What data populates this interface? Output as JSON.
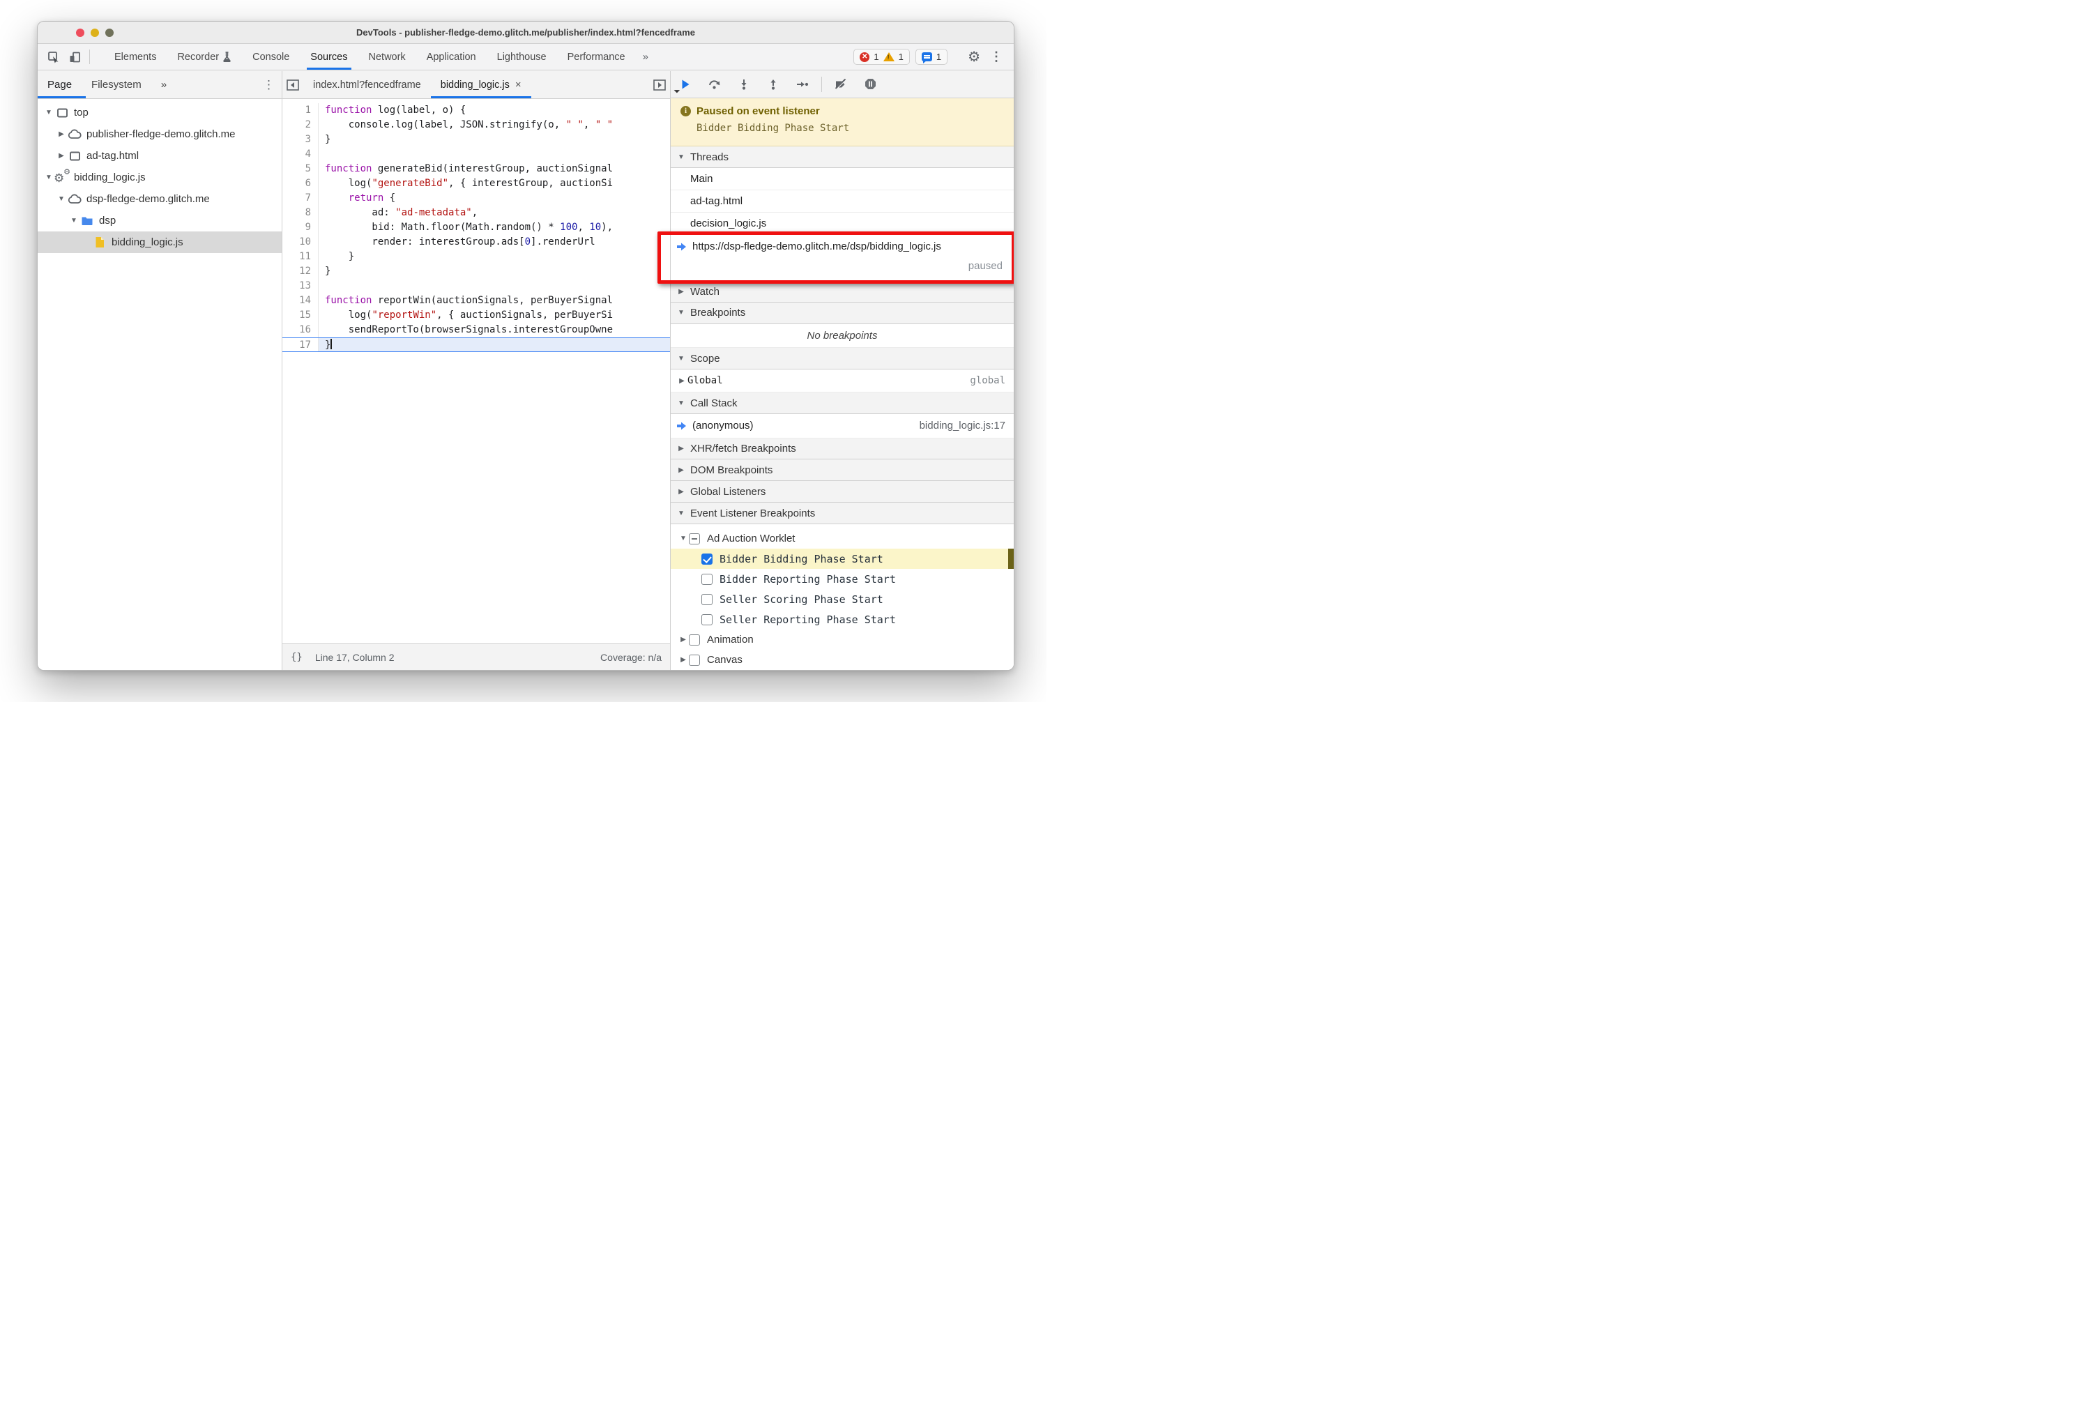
{
  "titlebar": {
    "title": "DevTools - publisher-fledge-demo.glitch.me/publisher/index.html?fencedframe"
  },
  "toolbar": {
    "tabs": [
      {
        "label": "Elements"
      },
      {
        "label": "Recorder",
        "flask": true
      },
      {
        "label": "Console"
      },
      {
        "label": "Sources",
        "active": true
      },
      {
        "label": "Network"
      },
      {
        "label": "Application"
      },
      {
        "label": "Lighthouse"
      },
      {
        "label": "Performance"
      }
    ],
    "overflow": "»",
    "badges": {
      "errors": "1",
      "warnings": "1",
      "messages": "1"
    },
    "kebab": "⋮"
  },
  "sidebar": {
    "tabs": [
      {
        "label": "Page",
        "active": true
      },
      {
        "label": "Filesystem"
      }
    ],
    "overflow": "»",
    "kebab": "⋮",
    "tree": [
      {
        "label": "top",
        "icon": "frame",
        "arrow": "down",
        "indent": 0
      },
      {
        "label": "publisher-fledge-demo.glitch.me",
        "icon": "cloud",
        "arrow": "right",
        "indent": 1
      },
      {
        "label": "ad-tag.html",
        "icon": "frame",
        "arrow": "right",
        "indent": 1
      },
      {
        "label": "bidding_logic.js",
        "icon": "worklet",
        "arrow": "down",
        "indent": 0
      },
      {
        "label": "dsp-fledge-demo.glitch.me",
        "icon": "cloud",
        "arrow": "down",
        "indent": 1
      },
      {
        "label": "dsp",
        "icon": "folder",
        "arrow": "down",
        "indent": 2
      },
      {
        "label": "bidding_logic.js",
        "icon": "file",
        "arrow": "none",
        "indent": 3,
        "selected": true
      }
    ]
  },
  "editor": {
    "tabs": [
      {
        "label": "index.html?fencedframe"
      },
      {
        "label": "bidding_logic.js",
        "active": true,
        "closable": true,
        "close_glyph": "×"
      }
    ],
    "paused_line": 17,
    "code": [
      {
        "n": "1",
        "tokens": [
          [
            "kw",
            "function"
          ],
          [
            "pl",
            " log(label, o) {"
          ]
        ]
      },
      {
        "n": "2",
        "tokens": [
          [
            "pl",
            "    console.log(label, JSON.stringify(o, "
          ],
          [
            "str",
            "\" \""
          ],
          [
            "pl",
            ", "
          ],
          [
            "str",
            "\" \""
          ]
        ]
      },
      {
        "n": "3",
        "tokens": [
          [
            "pl",
            "}"
          ]
        ]
      },
      {
        "n": "4",
        "tokens": []
      },
      {
        "n": "5",
        "tokens": [
          [
            "kw",
            "function"
          ],
          [
            "pl",
            " generateBid(interestGroup, auctionSignal"
          ]
        ]
      },
      {
        "n": "6",
        "tokens": [
          [
            "pl",
            "    log("
          ],
          [
            "str",
            "\"generateBid\""
          ],
          [
            "pl",
            ", { interestGroup, auctionSi"
          ]
        ]
      },
      {
        "n": "7",
        "tokens": [
          [
            "pl",
            "    "
          ],
          [
            "kw",
            "return"
          ],
          [
            "pl",
            " {"
          ]
        ]
      },
      {
        "n": "8",
        "tokens": [
          [
            "pl",
            "        ad: "
          ],
          [
            "str",
            "\"ad-metadata\""
          ],
          [
            "pl",
            ","
          ]
        ]
      },
      {
        "n": "9",
        "tokens": [
          [
            "pl",
            "        bid: Math.floor(Math.random() * "
          ],
          [
            "num",
            "100"
          ],
          [
            "pl",
            ", "
          ],
          [
            "num",
            "10"
          ],
          [
            "pl",
            "),"
          ]
        ]
      },
      {
        "n": "10",
        "tokens": [
          [
            "pl",
            "        render: interestGroup.ads["
          ],
          [
            "num",
            "0"
          ],
          [
            "pl",
            "].renderUrl"
          ]
        ]
      },
      {
        "n": "11",
        "tokens": [
          [
            "pl",
            "    }"
          ]
        ]
      },
      {
        "n": "12",
        "tokens": [
          [
            "pl",
            "}"
          ]
        ]
      },
      {
        "n": "13",
        "tokens": []
      },
      {
        "n": "14",
        "tokens": [
          [
            "kw",
            "function"
          ],
          [
            "pl",
            " reportWin(auctionSignals, perBuyerSignal"
          ]
        ]
      },
      {
        "n": "15",
        "tokens": [
          [
            "pl",
            "    log("
          ],
          [
            "str",
            "\"reportWin\""
          ],
          [
            "pl",
            ", { auctionSignals, perBuyerSi"
          ]
        ]
      },
      {
        "n": "16",
        "tokens": [
          [
            "pl",
            "    sendReportTo(browserSignals.interestGroupOwne"
          ]
        ]
      },
      {
        "n": "17",
        "tokens": [
          [
            "pl",
            "}"
          ]
        ],
        "highlight": true,
        "caret": true
      }
    ],
    "status": {
      "braces": "{}",
      "line_col": "Line 17, Column 2",
      "coverage": "Coverage: n/a"
    }
  },
  "rightpanel": {
    "debug_toolbar": {
      "icons": [
        "resume-icon",
        "step-over-icon",
        "step-into-icon",
        "step-out-icon",
        "step-icon",
        "divider",
        "deactivate-breakpoints-icon",
        "pause-on-exceptions-icon"
      ]
    },
    "paused_banner": {
      "title": "Paused on event listener",
      "detail": "Bidder Bidding Phase Start"
    },
    "threads": {
      "header": "Threads",
      "items": [
        {
          "label": "Main"
        },
        {
          "label": "ad-tag.html"
        },
        {
          "label": "decision_logic.js"
        },
        {
          "label": "https://dsp-fledge-demo.glitch.me/dsp/bidding_logic.js",
          "status": "paused",
          "current": true
        }
      ]
    },
    "watch": {
      "header": "Watch"
    },
    "breakpoints": {
      "header": "Breakpoints",
      "empty": "No breakpoints"
    },
    "scope": {
      "header": "Scope",
      "name": "Global",
      "value": "global"
    },
    "call_stack": {
      "header": "Call Stack",
      "frame": "(anonymous)",
      "location": "bidding_logic.js:17"
    },
    "xhr_breakpoints": {
      "header": "XHR/fetch Breakpoints"
    },
    "dom_breakpoints": {
      "header": "DOM Breakpoints"
    },
    "global_listeners": {
      "header": "Global Listeners"
    },
    "event_listener_breakpoints": {
      "header": "Event Listener Breakpoints",
      "group": {
        "label": "Ad Auction Worklet",
        "state": "indeterminate"
      },
      "items": [
        {
          "label": "Bidder Bidding Phase Start",
          "checked": true,
          "highlighted": true
        },
        {
          "label": "Bidder Reporting Phase Start"
        },
        {
          "label": "Seller Scoring Phase Start"
        },
        {
          "label": "Seller Reporting Phase Start"
        }
      ],
      "siblings": [
        {
          "label": "Animation"
        },
        {
          "label": "Canvas"
        }
      ]
    }
  },
  "colors": {
    "accent_blue": "#1a73e8",
    "annotation_red": "#ef1010",
    "banner_bg": "#fcf3d4",
    "banner_text": "#6e5f00",
    "highlight_row_yellow": "#fbf5c9",
    "selected_tree_row": "#d9d9d9"
  }
}
